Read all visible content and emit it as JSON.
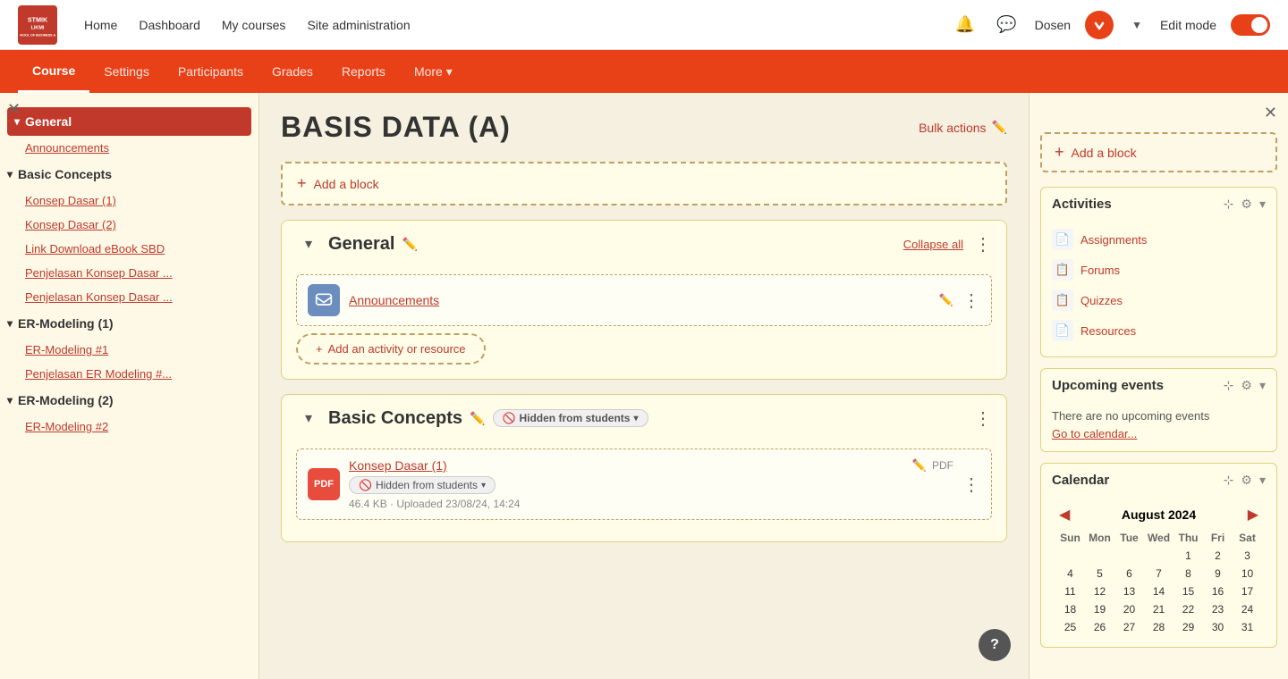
{
  "topnav": {
    "logo_line1": "STMIK LIKMI",
    "logo_line2": "SCHOOL OF BUSINESS & IT",
    "links": [
      "Home",
      "Dashboard",
      "My courses",
      "Site administration"
    ],
    "user": "Dosen",
    "edit_mode_label": "Edit mode"
  },
  "secondarynav": {
    "tabs": [
      "Course",
      "Settings",
      "Participants",
      "Grades",
      "Reports",
      "More ▾"
    ],
    "active": "Course"
  },
  "sidebar": {
    "sections": [
      {
        "id": "general",
        "label": "General",
        "active": true,
        "items": [
          "Announcements"
        ]
      },
      {
        "id": "basic-concepts",
        "label": "Basic Concepts",
        "active": false,
        "items": [
          "Konsep Dasar (1)",
          "Konsep Dasar (2)",
          "Link Download eBook SBD",
          "Penjelasan Konsep Dasar ...",
          "Penjelasan Konsep Dasar ..."
        ]
      },
      {
        "id": "er-modeling-1",
        "label": "ER-Modeling (1)",
        "active": false,
        "items": [
          "ER-Modeling #1",
          "Penjelasan ER Modeling #..."
        ]
      },
      {
        "id": "er-modeling-2",
        "label": "ER-Modeling (2)",
        "active": false,
        "items": [
          "ER-Modeling #2"
        ]
      }
    ]
  },
  "main": {
    "title": "BASIS DATA (A)",
    "bulk_actions_label": "Bulk actions",
    "add_block_label": "Add a block",
    "sections": [
      {
        "id": "general-section",
        "title": "General",
        "collapse_all_label": "Collapse all",
        "activities": [
          {
            "id": "announcements",
            "name": "Announcements",
            "icon_type": "chat",
            "has_edit": true
          }
        ],
        "add_activity_label": "Add an activity or resource"
      },
      {
        "id": "basic-concepts-section",
        "title": "Basic Concepts",
        "hidden_label": "Hidden from students",
        "activities": [
          {
            "id": "konsep-dasar-1",
            "name": "Konsep Dasar (1)",
            "type": "PDF",
            "icon_type": "pdf",
            "hidden_label": "Hidden from students",
            "file_meta": "46.4 KB · Uploaded 23/08/24, 14:24"
          }
        ]
      }
    ]
  },
  "right_panel": {
    "add_block_label": "Add a block",
    "activities_widget": {
      "title": "Activities",
      "links": [
        {
          "label": "Assignments",
          "icon": "📄"
        },
        {
          "label": "Forums",
          "icon": "📋"
        },
        {
          "label": "Quizzes",
          "icon": "📋"
        },
        {
          "label": "Resources",
          "icon": "📄"
        }
      ]
    },
    "upcoming_widget": {
      "title": "Upcoming events",
      "no_events_text": "There are no upcoming events",
      "go_calendar_label": "Go to calendar..."
    },
    "calendar_widget": {
      "title": "Calendar",
      "month_year": "August 2024",
      "day_headers": [
        "Sun",
        "Mon",
        "Tue",
        "Wed",
        "Thu",
        "Fri",
        "Sat"
      ],
      "days": [
        "",
        "",
        "",
        "",
        "1",
        "2",
        "3",
        "4",
        "5",
        "6",
        "7",
        "8",
        "9",
        "10",
        "11",
        "12",
        "13",
        "14",
        "15",
        "16",
        "17",
        "18",
        "19",
        "20",
        "21",
        "22",
        "23",
        "24",
        "25",
        "26",
        "27",
        "28",
        "29",
        "30",
        "31"
      ]
    }
  },
  "help_button_label": "?"
}
